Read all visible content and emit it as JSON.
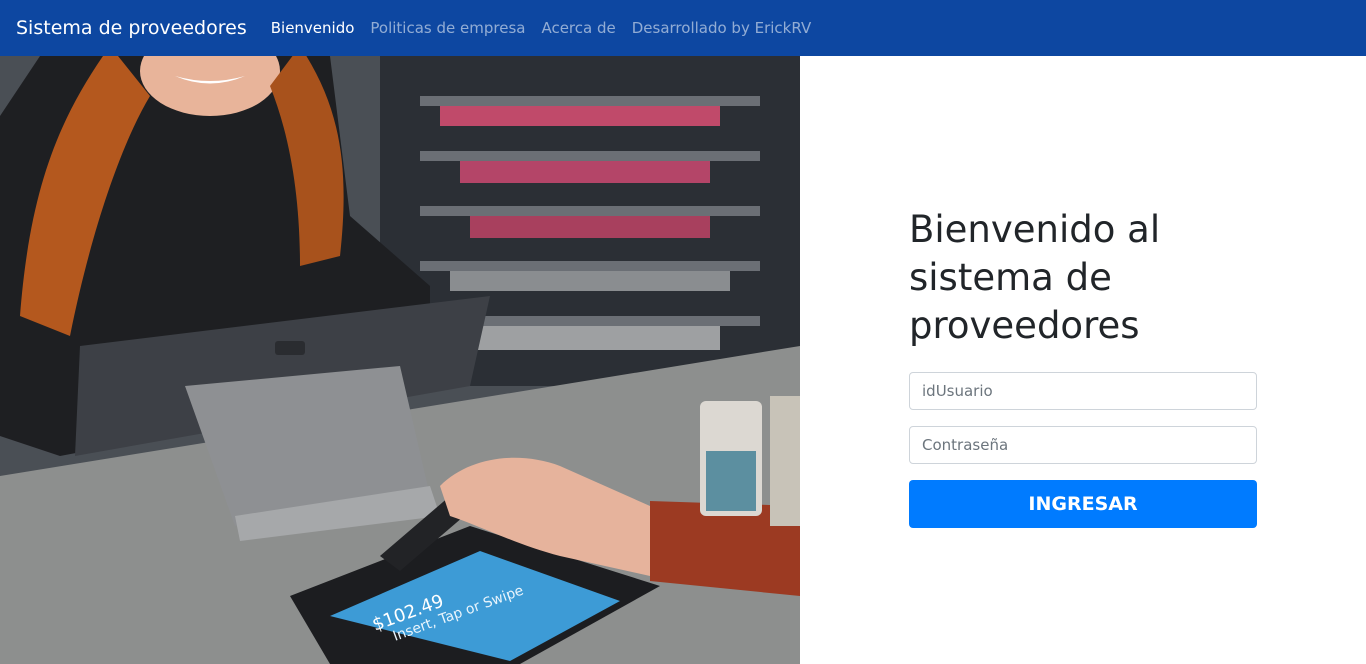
{
  "navbar": {
    "brand": "Sistema de proveedores",
    "links": [
      {
        "label": "Bienvenido",
        "active": true
      },
      {
        "label": "Politicas de empresa",
        "active": false
      },
      {
        "label": "Acerca de",
        "active": false
      },
      {
        "label": "Desarrollado by ErickRV",
        "active": false
      }
    ]
  },
  "hero_image": {
    "terminal_amount": "$102.49",
    "terminal_prompt": "Insert, Tap or Swipe"
  },
  "login": {
    "heading": "Bienvenido al sistema de proveedores",
    "user_placeholder": "idUsuario",
    "password_placeholder": "Contraseña",
    "submit_label": "INGRESAR"
  },
  "colors": {
    "navbar": "#0d47a1",
    "button": "#007bff"
  }
}
